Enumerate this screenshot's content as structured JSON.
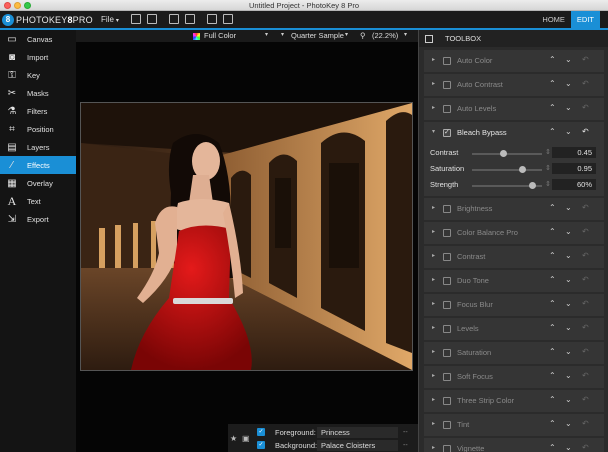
{
  "window": {
    "title": "Untitled Project - PhotoKey 8 Pro"
  },
  "logo": {
    "badge": "8",
    "brand": "PHOTOKEY",
    "version": "8",
    "edition": "PRO"
  },
  "menu": {
    "file_label": "File",
    "file_caret": "▾"
  },
  "mode_tabs": [
    {
      "label": "HOME",
      "active": false
    },
    {
      "label": "EDIT",
      "active": true
    }
  ],
  "sidebar": {
    "items": [
      {
        "label": "Canvas",
        "icon": "canvas-icon",
        "active": false
      },
      {
        "label": "Import",
        "icon": "camera-icon",
        "active": false
      },
      {
        "label": "Key",
        "icon": "key-icon",
        "active": false
      },
      {
        "label": "Masks",
        "icon": "scissors-icon",
        "active": false
      },
      {
        "label": "Filters",
        "icon": "filters-icon",
        "active": false
      },
      {
        "label": "Position",
        "icon": "crop-icon",
        "active": false
      },
      {
        "label": "Layers",
        "icon": "layers-icon",
        "active": false
      },
      {
        "label": "Effects",
        "icon": "magic-wand-icon",
        "active": true
      },
      {
        "label": "Overlay",
        "icon": "grid-icon",
        "active": false
      },
      {
        "label": "Text",
        "icon": "text-icon",
        "active": false
      },
      {
        "label": "Export",
        "icon": "export-icon",
        "active": false
      }
    ]
  },
  "canvas_toolbar": {
    "color_mode": "Full Color",
    "quality": "Quarter Sample",
    "zoom": "(22.2%)"
  },
  "layers": {
    "foreground_label": "Foreground:",
    "foreground_value": "Princess",
    "background_label": "Background:",
    "background_value": "Palace Cloisters",
    "dash": "--"
  },
  "toolbox": {
    "title": "TOOLBOX",
    "effects": [
      {
        "name": "Auto Color",
        "enabled": false,
        "expanded": false
      },
      {
        "name": "Auto Contrast",
        "enabled": false,
        "expanded": false
      },
      {
        "name": "Auto Levels",
        "enabled": false,
        "expanded": false
      },
      {
        "name": "Bleach Bypass",
        "enabled": true,
        "expanded": true,
        "params": [
          {
            "label": "Contrast",
            "value": "0.45",
            "fraction": 0.45
          },
          {
            "label": "Saturation",
            "value": "0.95",
            "fraction": 0.75
          },
          {
            "label": "Strength",
            "value": "60%",
            "fraction": 0.9
          }
        ]
      },
      {
        "name": "Brightness",
        "enabled": false,
        "expanded": false
      },
      {
        "name": "Color Balance Pro",
        "enabled": false,
        "expanded": false
      },
      {
        "name": "Contrast",
        "enabled": false,
        "expanded": false
      },
      {
        "name": "Duo Tone",
        "enabled": false,
        "expanded": false
      },
      {
        "name": "Focus Blur",
        "enabled": false,
        "expanded": false
      },
      {
        "name": "Levels",
        "enabled": false,
        "expanded": false
      },
      {
        "name": "Saturation",
        "enabled": false,
        "expanded": false
      },
      {
        "name": "Soft Focus",
        "enabled": false,
        "expanded": false
      },
      {
        "name": "Three Strip Color",
        "enabled": false,
        "expanded": false
      },
      {
        "name": "Tint",
        "enabled": false,
        "expanded": false
      },
      {
        "name": "Vignette",
        "enabled": false,
        "expanded": false
      }
    ]
  },
  "colors": {
    "accent": "#1a8fd6",
    "panel": "#353535",
    "background": "#050505"
  }
}
